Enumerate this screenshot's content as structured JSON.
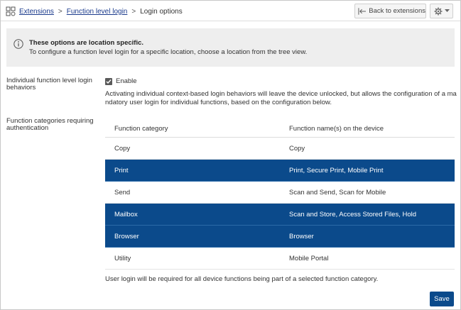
{
  "header": {
    "breadcrumb": {
      "root": "Extensions",
      "sep1": ">",
      "middle": "Function level login",
      "sep2": ">",
      "current": "Login options"
    },
    "back_button": "Back to extensions",
    "settings_icon": "gear-icon"
  },
  "info": {
    "title": "These options are location specific.",
    "text": "To configure a function level login for a specific location, choose a location from the tree view."
  },
  "individual": {
    "label": "Individual function level login behaviors",
    "checkbox_label": "Enable",
    "checked": true,
    "description": "Activating individual context-based login behaviors will leave the device unlocked, but allows the configuration of a mandatory user login for individual functions, based on the configuration below."
  },
  "categories": {
    "label": "Function categories requiring authentication",
    "columns": [
      "Function category",
      "Function name(s) on the device"
    ],
    "rows": [
      {
        "category": "Copy",
        "functions": "Copy",
        "selected": false
      },
      {
        "category": "Print",
        "functions": "Print, Secure Print, Mobile Print",
        "selected": true
      },
      {
        "category": "Send",
        "functions": "Scan and Send, Scan for Mobile",
        "selected": false
      },
      {
        "category": "Mailbox",
        "functions": "Scan and Store, Access Stored Files, Hold",
        "selected": true
      },
      {
        "category": "Browser",
        "functions": "Browser",
        "selected": true
      },
      {
        "category": "Utility",
        "functions": "Mobile Portal",
        "selected": false
      }
    ],
    "footnote": "User login will be required for all device functions being part of a selected function category."
  },
  "save_button": "Save",
  "colors": {
    "selected_row": "#0b4a8b",
    "link": "#1a3a8c",
    "info_bg": "#eeeeee"
  }
}
